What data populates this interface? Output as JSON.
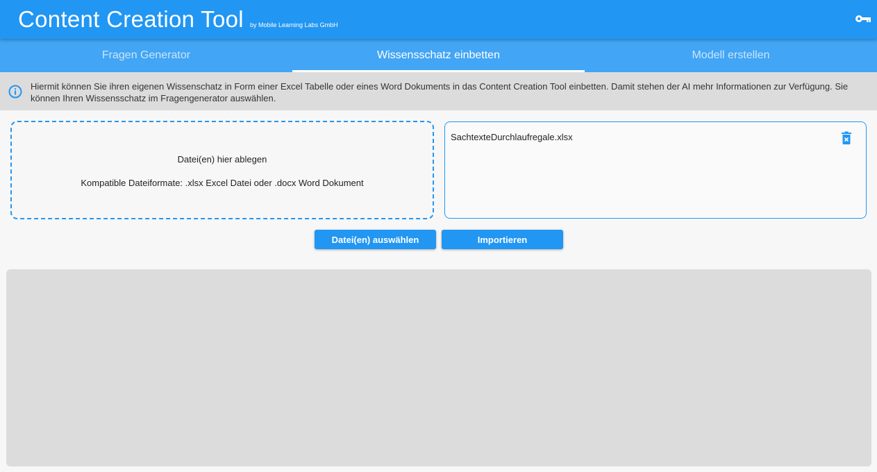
{
  "app": {
    "title": "Content Creation Tool",
    "subtitle": "by Mobile Learning Labs GmbH",
    "key_icon": "key-icon",
    "accent_color": "#2196f3"
  },
  "tabs": [
    {
      "label": "Fragen Generator",
      "active": false
    },
    {
      "label": "Wissensschatz einbetten",
      "active": true
    },
    {
      "label": "Modell erstellen",
      "active": false
    }
  ],
  "info": {
    "icon": "info-icon",
    "text": "Hiermit können Sie ihren eigenen Wissenschatz in Form einer Excel Tabelle oder eines Word Dokuments in das Content Creation Tool einbetten. Damit stehen der AI mehr Informationen zur Verfügung. Sie können Ihren Wissensschatz im Fragengenerator auswählen."
  },
  "dropzone": {
    "title": "Datei(en) hier ablegen",
    "subtitle": "Kompatible Dateiformate: .xlsx Excel Datei oder .docx Word Dokument"
  },
  "files": [
    {
      "name": "SachtexteDurchlaufregale.xlsx",
      "icon": "delete-icon"
    }
  ],
  "buttons": {
    "select": "Datei(en) auswählen",
    "import": "Importieren"
  }
}
